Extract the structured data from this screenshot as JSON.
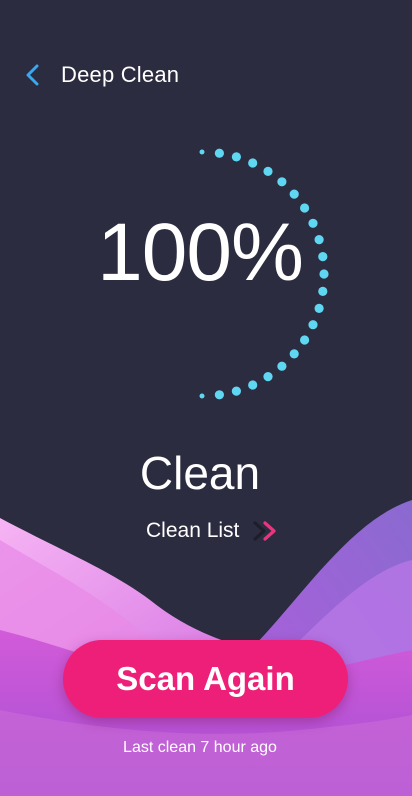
{
  "header": {
    "back_icon": "chevron-left-icon",
    "title": "Deep Clean"
  },
  "progress": {
    "percent_label": "100%",
    "value": 1.0
  },
  "status": {
    "label": "Clean"
  },
  "clean_list": {
    "label": "Clean List",
    "icon": "chevron-right-icon"
  },
  "actions": {
    "scan_label": "Scan Again"
  },
  "footer": {
    "last_clean_text": "Last clean 7 hour ago"
  },
  "colors": {
    "background": "#2b2c3f",
    "ring_dots": "#5fd6f2",
    "accent_blue": "#3aa7ee",
    "scan_button": "#ee1f78",
    "chevron_pink": "#e9357f",
    "wave_purple": "#b35fd6",
    "wave_pink": "#f3a8f1"
  }
}
